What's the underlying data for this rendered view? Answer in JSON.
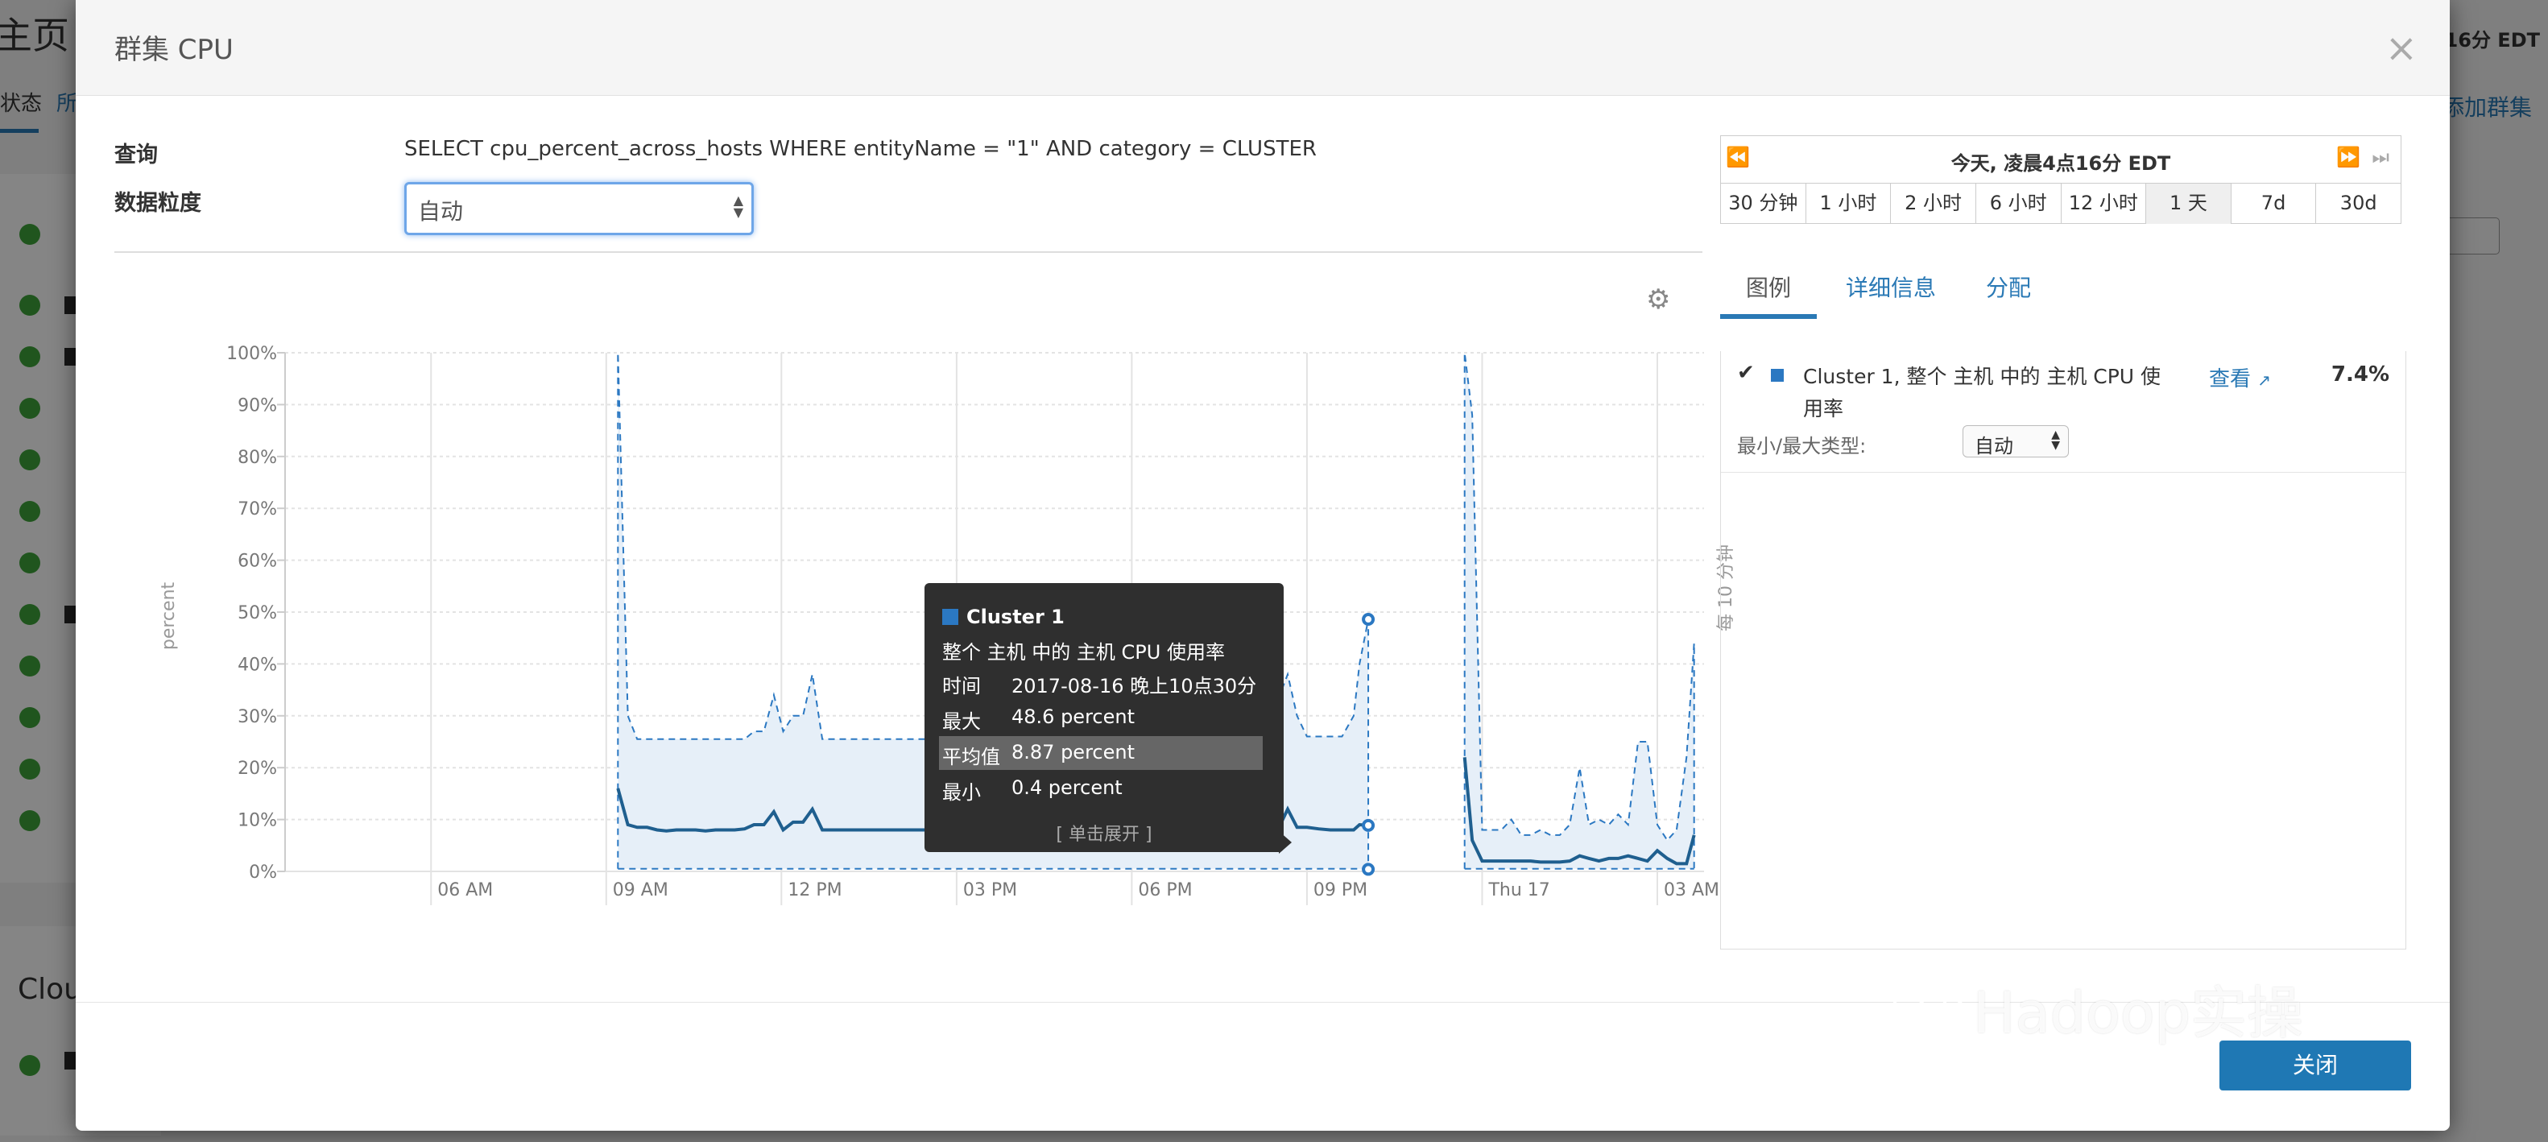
{
  "background": {
    "page_title": "主页",
    "tab_status": "状态",
    "tab_all": "所",
    "time": "16分 EDT",
    "add_cluster": "添加群集",
    "cloud_label": "Clou"
  },
  "modal": {
    "title": "群集 CPU",
    "close_symbol": "×",
    "query_label": "查询",
    "query_text": "SELECT cpu_percent_across_hosts WHERE entityName = \"1\" AND category = CLUSTER",
    "granularity_label": "数据粒度",
    "granularity_value": "自动",
    "close_button": "关闭"
  },
  "chart_data": {
    "type": "line",
    "ylabel": "percent",
    "right_label": "每 10 分钟",
    "y_ticks": [
      "0%",
      "10%",
      "20%",
      "30%",
      "40%",
      "50%",
      "60%",
      "70%",
      "80%",
      "90%",
      "100%"
    ],
    "ylim": [
      0,
      100
    ],
    "x_ticks": [
      "06 AM",
      "09 AM",
      "12 PM",
      "03 PM",
      "06 PM",
      "09 PM",
      "Thu 17",
      "03 AM"
    ],
    "x_tick_hours": [
      30,
      33,
      36,
      39,
      42,
      45,
      48,
      51
    ],
    "xlim_hours": [
      27.5,
      51.8
    ],
    "grid": true,
    "series": [
      {
        "name": "Cluster 1",
        "color": "#1f5f8f",
        "segments": [
          {
            "x": [
              33.2,
              33.37,
              33.53,
              33.7,
              33.87,
              34.03,
              34.2,
              34.37,
              34.53,
              34.7,
              34.87,
              35.03,
              35.2,
              35.37,
              35.53,
              35.7,
              35.87,
              36.03,
              36.2,
              36.37,
              36.53,
              36.7,
              36.87,
              37.03,
              37.2,
              37.5,
              38,
              38.5,
              39,
              39.5,
              40,
              40.5,
              41,
              41.5,
              42,
              42.5,
              43,
              43.5,
              43.67,
              43.83,
              44,
              44.17,
              44.33,
              44.5,
              44.67,
              44.83,
              45,
              45.2,
              45.4,
              45.6,
              45.8,
              45.9,
              46.05
            ],
            "mean": [
              16,
              9,
              8.5,
              8.5,
              8,
              7.8,
              8,
              8,
              8,
              7.8,
              8,
              8,
              8,
              8.2,
              9,
              9,
              11.5,
              8,
              9.5,
              9.5,
              12,
              8,
              8,
              8,
              8,
              8,
              8,
              8,
              8,
              8,
              8,
              8,
              8,
              8,
              8,
              8,
              8,
              8,
              8,
              8,
              11,
              8,
              8,
              8,
              12,
              8.5,
              8.5,
              8.2,
              8,
              8,
              8,
              9,
              8.87
            ],
            "max": [
              100,
              30,
              25.5,
              25.5,
              25.5,
              25.5,
              25.5,
              25.5,
              25.5,
              25.5,
              25.5,
              25.5,
              25.5,
              25.5,
              27,
              27,
              34,
              27,
              30,
              30,
              38,
              25.5,
              25.5,
              25.5,
              25.5,
              25.5,
              25.5,
              25.5,
              25.5,
              25.5,
              25.5,
              25.5,
              25.5,
              25.5,
              25.5,
              25.5,
              25.5,
              25.5,
              27,
              30,
              36,
              28,
              30,
              33,
              38,
              30,
              26,
              26,
              26,
              26,
              30,
              40,
              48.6
            ],
            "min": [
              0.5,
              0.5,
              0.5,
              0.5,
              0.5,
              0.5,
              0.5,
              0.5,
              0.5,
              0.5,
              0.5,
              0.5,
              0.5,
              0.5,
              0.5,
              0.5,
              0.5,
              0.5,
              0.5,
              0.5,
              0.5,
              0.5,
              0.5,
              0.5,
              0.5,
              0.5,
              0.5,
              0.5,
              0.5,
              0.5,
              0.5,
              0.5,
              0.5,
              0.5,
              0.5,
              0.5,
              0.5,
              0.5,
              0.5,
              0.5,
              0.5,
              0.5,
              0.5,
              0.5,
              0.5,
              0.5,
              0.5,
              0.5,
              0.5,
              0.5,
              0.5,
              0.5,
              0.4
            ]
          },
          {
            "x": [
              47.7,
              47.83,
              48,
              48.17,
              48.33,
              48.5,
              48.67,
              48.83,
              49,
              49.17,
              49.33,
              49.5,
              49.67,
              49.83,
              50,
              50.17,
              50.33,
              50.5,
              50.67,
              50.83,
              51,
              51.17,
              51.33,
              51.5,
              51.63
            ],
            "mean": [
              22,
              6,
              2,
              2,
              2,
              2,
              2,
              2,
              1.8,
              1.8,
              1.8,
              2,
              3,
              2.5,
              2,
              2.5,
              2.5,
              3,
              2.5,
              2,
              4,
              2.5,
              1.5,
              1.5,
              7
            ],
            "max": [
              100,
              88,
              8,
              8,
              8,
              10,
              7,
              7,
              8,
              7,
              7,
              9,
              20,
              9,
              10,
              9,
              11,
              9,
              25,
              25,
              9,
              6,
              8,
              22,
              44
            ],
            "min": [
              0.5,
              0.5,
              0.5,
              0.5,
              0.5,
              0.5,
              0.5,
              0.5,
              0.5,
              0.5,
              0.5,
              0.5,
              0.5,
              0.5,
              0.5,
              0.5,
              0.5,
              0.5,
              0.5,
              0.5,
              0.5,
              0.5,
              0.5,
              0.5,
              0.5
            ]
          }
        ]
      }
    ],
    "hover_point": {
      "x": 46.05,
      "max": 48.6,
      "mean": 8.87,
      "min": 0.4
    }
  },
  "tooltip": {
    "name": "Cluster 1",
    "metric": "整个 主机 中的 主机 CPU 使用率",
    "time_label": "时间",
    "time_value": "2017-08-16 晚上10点30分",
    "max_label": "最大",
    "max_value": "48.6 percent",
    "avg_label": "平均值",
    "avg_value": "8.87 percent",
    "min_label": "最小",
    "min_value": "0.4 percent",
    "expand": "[ 单击展开 ]"
  },
  "time_range": {
    "current": "今天, 凌晨4点16分 EDT",
    "prev_icon": "rewind-icon",
    "next_icon": "fast-forward-icon",
    "end_icon": "skip-to-end-icon",
    "buttons": [
      "30 分钟",
      "1 小时",
      "2 小时",
      "6 小时",
      "12 小时",
      "1 天",
      "7d",
      "30d"
    ],
    "active": "1 天"
  },
  "tabs": [
    "图例",
    "详细信息",
    "分配"
  ],
  "legend": {
    "check": "✔",
    "name": "Cluster 1, 整个 主机 中的 主机 CPU 使用率",
    "view": "查看",
    "value": "7.4%",
    "minmax_label": "最小/最大类型:",
    "minmax_value": "自动",
    "color": "#2b78c2"
  },
  "watermark": "Hadoop实操"
}
